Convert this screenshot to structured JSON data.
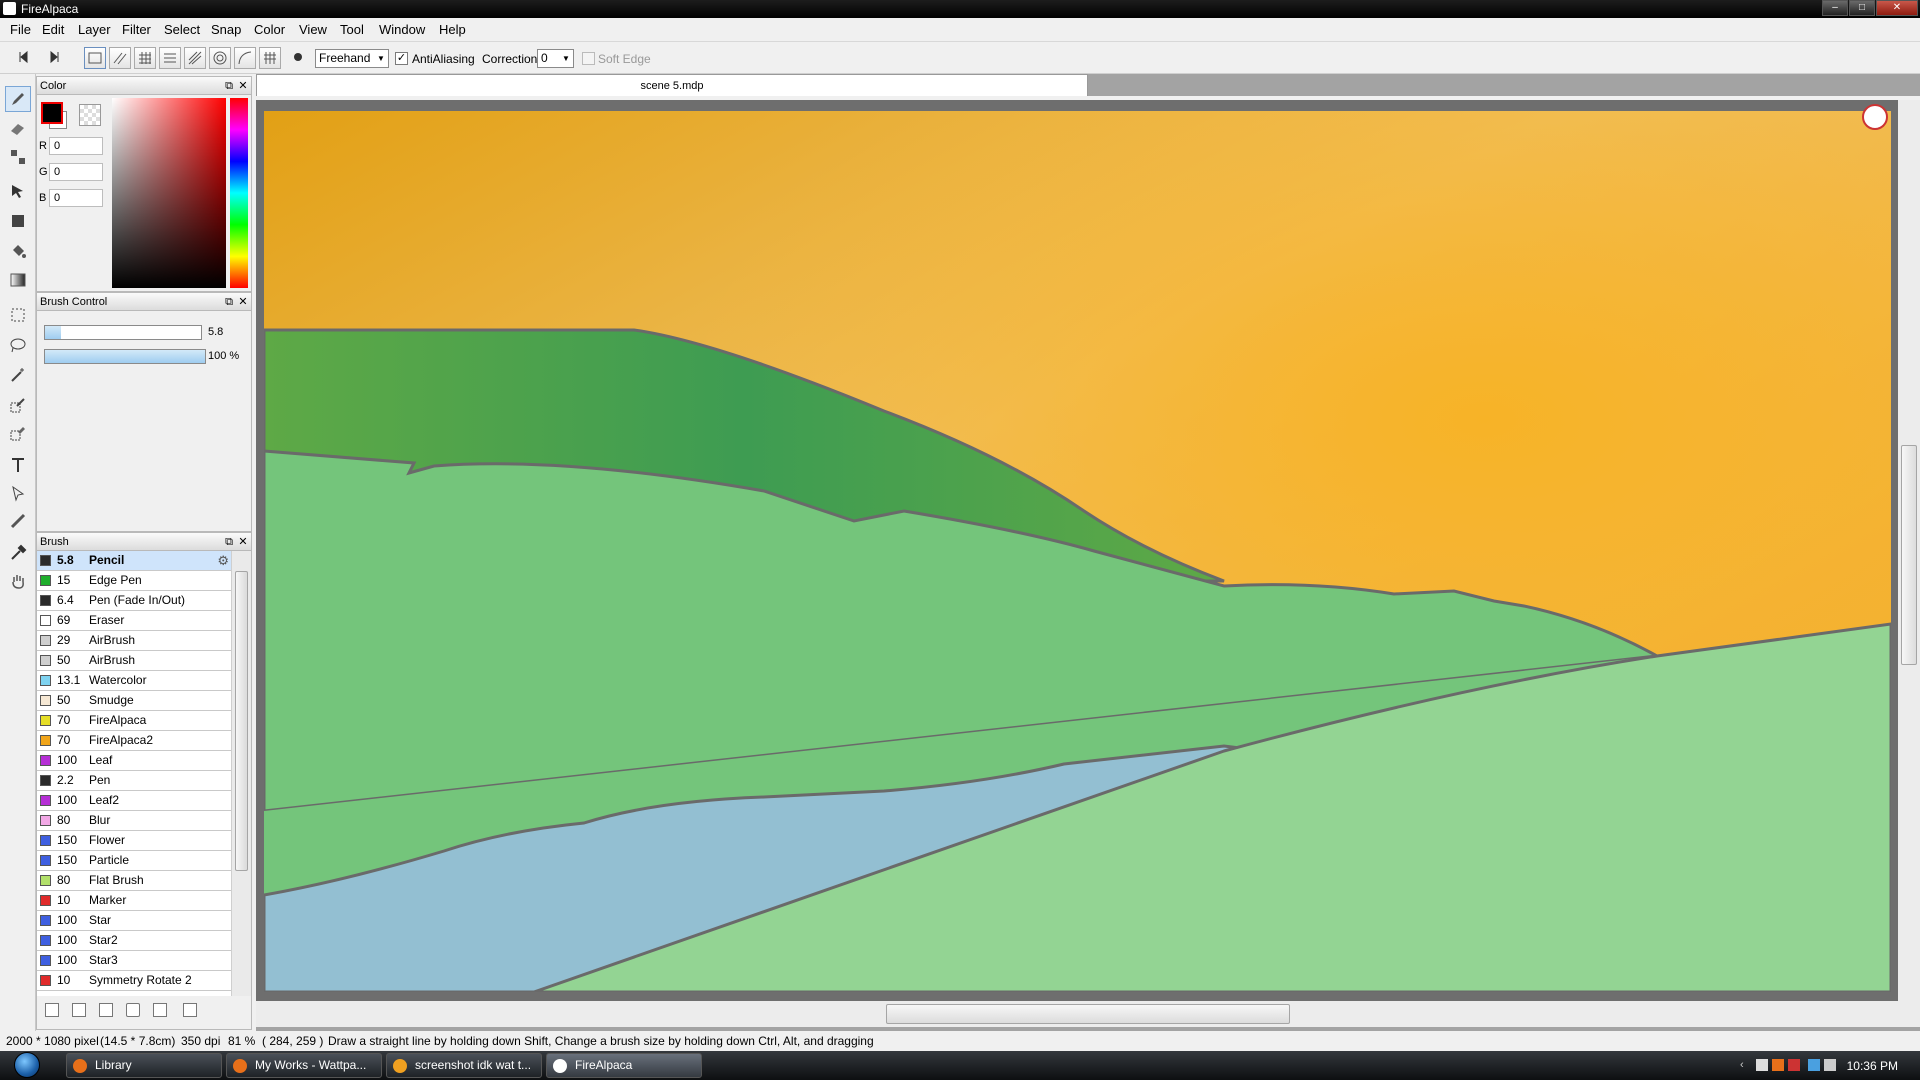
{
  "app": {
    "title": "FireAlpaca"
  },
  "window_controls": {
    "minimize": "–",
    "maximize": "□",
    "close": "✕"
  },
  "menu": [
    "File",
    "Edit",
    "Layer",
    "Filter",
    "Select",
    "Snap",
    "Color",
    "View",
    "Tool",
    "Window",
    "Help"
  ],
  "toolbar": {
    "mode": "Freehand",
    "antialiasing_checked": "✓",
    "antialiasing_label": "AntiAliasing",
    "correction_label": "Correction",
    "correction_value": "0",
    "soft_edge_label": "Soft Edge",
    "mode_arrow": "▼",
    "correction_arrow": "▼"
  },
  "color_panel": {
    "title": "Color",
    "r_label": "R",
    "g_label": "G",
    "b_label": "B",
    "r": "0",
    "g": "0",
    "b": "0",
    "primary_color": "#000000",
    "secondary_color": "#ffffff"
  },
  "brush_control": {
    "title": "Brush Control",
    "size_value": "5.8",
    "opacity_value": "100 %",
    "size_fraction": 0.1,
    "opacity_fraction": 1.0
  },
  "brush_panel": {
    "title": "Brush",
    "items": [
      {
        "size": "5.8",
        "name": "Pencil",
        "color": "#2b2b2b",
        "selected": true
      },
      {
        "size": "15",
        "name": "Edge Pen",
        "color": "#1fae2c"
      },
      {
        "size": "6.4",
        "name": "Pen (Fade In/Out)",
        "color": "#2b2b2b"
      },
      {
        "size": "69",
        "name": "Eraser",
        "color": "#ffffff"
      },
      {
        "size": "29",
        "name": "AirBrush",
        "color": "#cfcfcf"
      },
      {
        "size": "50",
        "name": "AirBrush",
        "color": "#cfcfcf"
      },
      {
        "size": "13.1",
        "name": "Watercolor",
        "color": "#7fd3f0"
      },
      {
        "size": "50",
        "name": "Smudge",
        "color": "#f6e8d4"
      },
      {
        "size": "70",
        "name": "FireAlpaca",
        "color": "#e6de27"
      },
      {
        "size": "70",
        "name": "FireAlpaca2",
        "color": "#f0a51a"
      },
      {
        "size": "100",
        "name": "Leaf",
        "color": "#b62fd6"
      },
      {
        "size": "2.2",
        "name": "Pen",
        "color": "#2b2b2b"
      },
      {
        "size": "100",
        "name": "Leaf2",
        "color": "#b62fd6"
      },
      {
        "size": "80",
        "name": "Blur",
        "color": "#f2a8e6"
      },
      {
        "size": "150",
        "name": "Flower",
        "color": "#3f5fe0"
      },
      {
        "size": "150",
        "name": "Particle",
        "color": "#3f5fe0"
      },
      {
        "size": "80",
        "name": "Flat Brush",
        "color": "#b2e06a"
      },
      {
        "size": "10",
        "name": "Marker",
        "color": "#e02b2b"
      },
      {
        "size": "100",
        "name": "Star",
        "color": "#3f5fe0"
      },
      {
        "size": "100",
        "name": "Star2",
        "color": "#3f5fe0"
      },
      {
        "size": "100",
        "name": "Star3",
        "color": "#3f5fe0"
      },
      {
        "size": "10",
        "name": "Symmetry Rotate 2",
        "color": "#e02b2b"
      }
    ]
  },
  "document": {
    "tab_title": "scene 5.mdp"
  },
  "statusbar": {
    "dimensions": "2000 * 1080 pixel",
    "physical": "(14.5 * 7.8cm)",
    "dpi": "350 dpi",
    "zoom": "81 %",
    "cursor": "( 284, 259 )",
    "hint": "Draw a straight line by holding down Shift, Change a brush size by holding down Ctrl, Alt, and dragging"
  },
  "taskbar": {
    "tasks": [
      {
        "label": "Library",
        "icon_color": "#e8701a"
      },
      {
        "label": "My Works - Wattpa...",
        "icon_color": "#e8701a"
      },
      {
        "label": "screenshot idk wat t...",
        "icon_color": "#f0a020"
      },
      {
        "label": "FireAlpaca",
        "icon_color": "#ffffff",
        "active": true
      }
    ],
    "clock": "10:36 PM"
  }
}
